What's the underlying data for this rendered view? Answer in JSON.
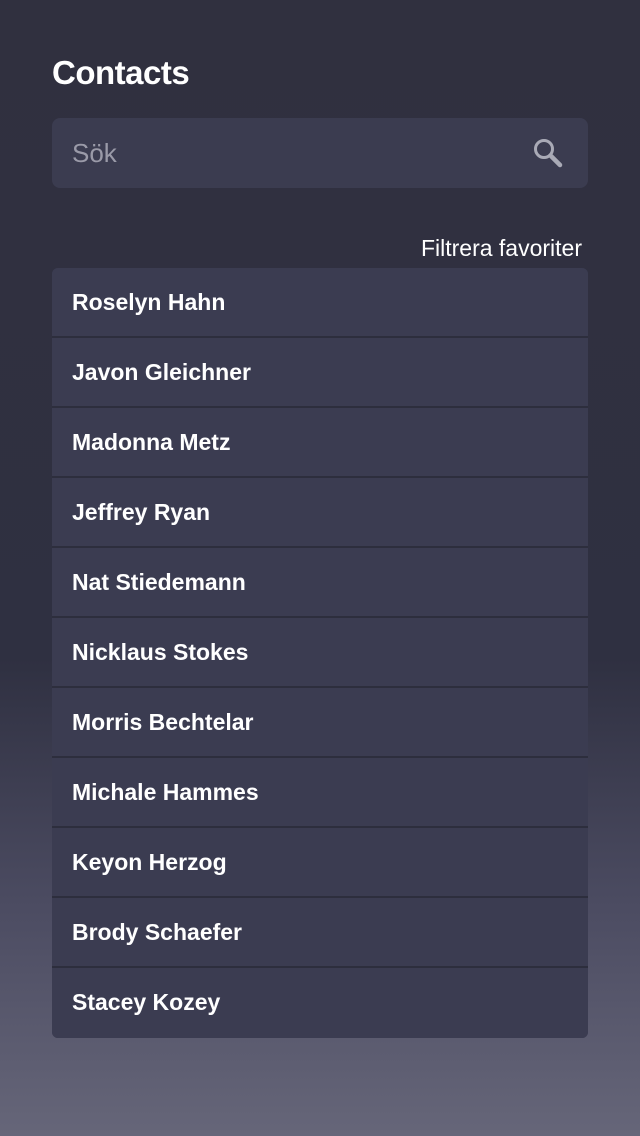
{
  "header": {
    "title": "Contacts"
  },
  "search": {
    "placeholder": "Sök",
    "value": ""
  },
  "filter": {
    "label": "Filtrera favoriter"
  },
  "contacts": [
    "Roselyn Hahn",
    "Javon Gleichner",
    "Madonna Metz",
    "Jeffrey Ryan",
    "Nat Stiedemann",
    "Nicklaus Stokes",
    "Morris Bechtelar",
    "Michale Hammes",
    "Keyon Herzog",
    "Brody Schaefer",
    "Stacey Kozey"
  ],
  "icons": {
    "search": "search-icon"
  },
  "colors": {
    "background_top": "#30303f",
    "background_bottom": "#666679",
    "panel": "#3b3c50",
    "text": "#ffffff",
    "placeholder": "#9a9aa8"
  }
}
